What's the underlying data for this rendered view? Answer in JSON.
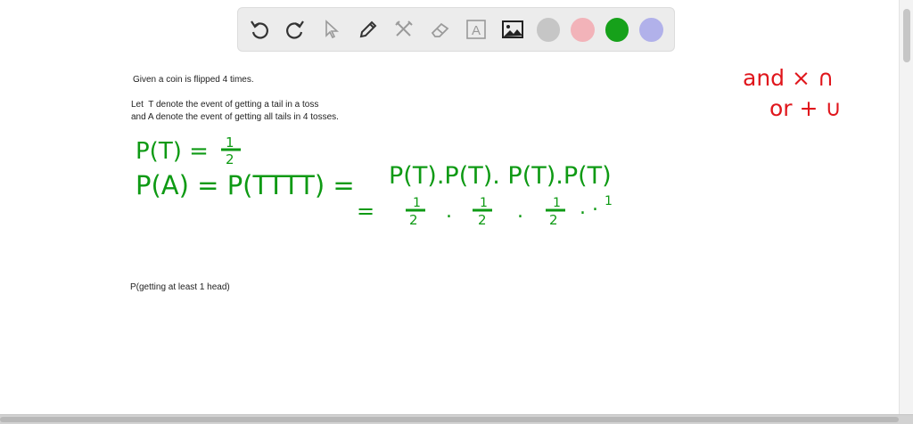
{
  "toolbar": {
    "tools": [
      {
        "name": "undo-icon"
      },
      {
        "name": "redo-icon"
      },
      {
        "name": "pointer-icon"
      },
      {
        "name": "pen-icon"
      },
      {
        "name": "tools-icon"
      },
      {
        "name": "eraser-icon"
      },
      {
        "name": "text-tool-icon",
        "glyph": "A"
      },
      {
        "name": "image-icon"
      }
    ],
    "colors": [
      "#c6c6c6",
      "#f2b3b9",
      "#16a11a",
      "#b1b1ea"
    ]
  },
  "typed_text": {
    "line1": "Given a coin is flipped 4 times.",
    "line2": "Let  T denote the event of getting a tail in a toss",
    "line3": "and A denote the event of getting all tails in 4 tosses.",
    "line4": "P(getting at least 1 head)"
  },
  "handwriting": {
    "green_color": "#0e9a14",
    "red_color": "#e0161c",
    "eq1_lhs": "P(T) =",
    "eq1_num": "1",
    "eq1_den": "2",
    "eq2_lhs": "P(A) = P(TTTT) =",
    "eq2_rhs": "P(T).P(T). P(T).P(T)",
    "eq3_eq": "=",
    "eq3_frac_num": "1",
    "eq3_frac_den": "2",
    "eq3_dot": ".",
    "red_line1": "and × ∩",
    "red_line2": "or + ∪"
  }
}
